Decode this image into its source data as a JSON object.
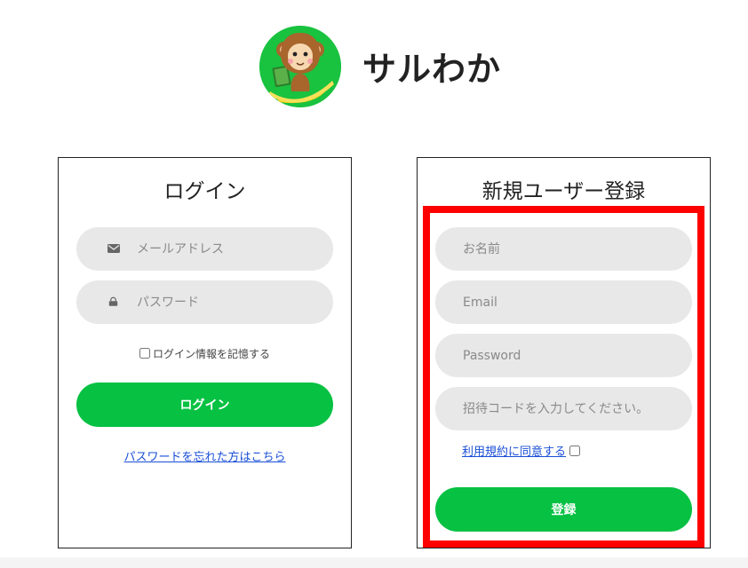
{
  "brand": {
    "name": "サルわか",
    "logo_icon": "monkey-mascot-icon"
  },
  "login": {
    "title": "ログイン",
    "email_placeholder": "メールアドレス",
    "password_placeholder": "パスワード",
    "remember_label": "ログイン情報を記憶する",
    "submit_label": "ログイン",
    "forgot_link": "パスワードを忘れた方はこちら"
  },
  "register": {
    "title": "新規ユーザー登録",
    "name_placeholder": "お名前",
    "email_placeholder": "Email",
    "password_placeholder": "Password",
    "invite_placeholder": "招待コードを入力してください。",
    "terms_link": "利用規約に同意する",
    "submit_label": "登録"
  },
  "colors": {
    "accent": "#06c142",
    "field_bg": "#e8e8e8",
    "highlight": "#ff0000",
    "link": "#1a4fd6"
  }
}
